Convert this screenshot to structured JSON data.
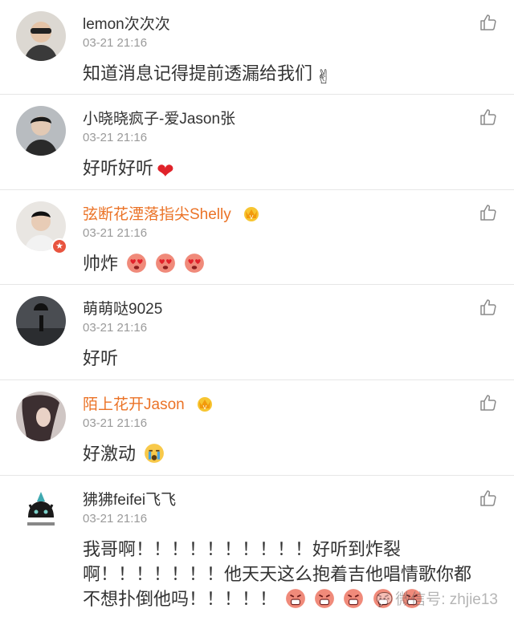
{
  "comments": [
    {
      "name": "lemon次次次",
      "time": "03-21 21:16",
      "text": "知道消息记得提前透漏给我们",
      "emoji": "victory-hand-emoji",
      "vip": false
    },
    {
      "name": "小晓晓疯子-爱Jason张",
      "time": "03-21 21:16",
      "text": "好听好听",
      "emoji": "red-heart-emoji",
      "vip": false
    },
    {
      "name": "弦断花湮落指尖Shelly",
      "time": "03-21 21:16",
      "text": "帅炸",
      "emoji": "heart-eyes-emoji x3",
      "vip": true,
      "verified_badge": "★"
    },
    {
      "name": "萌萌哒9025",
      "time": "03-21 21:16",
      "text": "好听",
      "vip": false
    },
    {
      "name": "陌上花开Jason",
      "time": "03-21 21:16",
      "text": "好激动",
      "emoji": "crying-emoji",
      "vip": true
    },
    {
      "name": "狒狒feifei飞飞",
      "time": "03-21 21:16",
      "text_lines": [
        "我哥啊！！！！！！！！！！好听到炸裂",
        "啊！！！！！！！他天天这么抱着吉他唱情歌你都",
        "不想扑倒他吗！！！！！"
      ],
      "emoji": "angry-face-emoji x5",
      "vip": false
    }
  ],
  "watermark": "微信号: zhjie13",
  "colors": {
    "vip_name": "#eb7327",
    "normal_name": "#333333",
    "time": "#9a9a9a",
    "divider": "#e6e6e6"
  }
}
